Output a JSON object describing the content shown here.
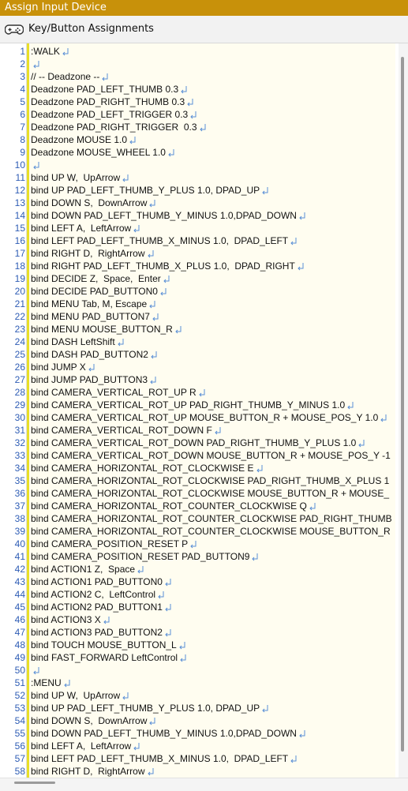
{
  "window": {
    "title": "Assign Input Device"
  },
  "header": {
    "icon": "gamepad-icon",
    "title": "Key/Button Assignments"
  },
  "colors": {
    "titlebar": "#c8910a",
    "line_numbers": "#2f5db5",
    "marker": "#5a8fd6",
    "gutter_bar": "#e8de28",
    "code_background": "#fffdf0"
  },
  "editor": {
    "lines": [
      ":WALK",
      "",
      "// -- Deadzone --",
      "Deadzone PAD_LEFT_THUMB 0.3",
      "Deadzone PAD_RIGHT_THUMB 0.3",
      "Deadzone PAD_LEFT_TRIGGER 0.3",
      "Deadzone PAD_RIGHT_TRIGGER  0.3",
      "Deadzone MOUSE 1.0",
      "Deadzone MOUSE_WHEEL 1.0",
      "",
      "bind UP W,  UpArrow",
      "bind UP PAD_LEFT_THUMB_Y_PLUS 1.0, DPAD_UP",
      "bind DOWN S,  DownArrow",
      "bind DOWN PAD_LEFT_THUMB_Y_MINUS 1.0,DPAD_DOWN",
      "bind LEFT A,  LeftArrow",
      "bind LEFT PAD_LEFT_THUMB_X_MINUS 1.0,  DPAD_LEFT",
      "bind RIGHT D,  RightArrow",
      "bind RIGHT PAD_LEFT_THUMB_X_PLUS 1.0,  DPAD_RIGHT",
      "bind DECIDE Z,  Space,  Enter",
      "bind DECIDE PAD_BUTTON0",
      "bind MENU Tab, M, Escape",
      "bind MENU PAD_BUTTON7",
      "bind MENU MOUSE_BUTTON_R",
      "bind DASH LeftShift",
      "bind DASH PAD_BUTTON2",
      "bind JUMP X",
      "bind JUMP PAD_BUTTON3",
      "bind CAMERA_VERTICAL_ROT_UP R",
      "bind CAMERA_VERTICAL_ROT_UP PAD_RIGHT_THUMB_Y_MINUS 1.0",
      "bind CAMERA_VERTICAL_ROT_UP MOUSE_BUTTON_R + MOUSE_POS_Y 1.0",
      "bind CAMERA_VERTICAL_ROT_DOWN F",
      "bind CAMERA_VERTICAL_ROT_DOWN PAD_RIGHT_THUMB_Y_PLUS 1.0",
      "bind CAMERA_VERTICAL_ROT_DOWN MOUSE_BUTTON_R + MOUSE_POS_Y -1",
      "bind CAMERA_HORIZONTAL_ROT_CLOCKWISE E",
      "bind CAMERA_HORIZONTAL_ROT_CLOCKWISE PAD_RIGHT_THUMB_X_PLUS 1",
      "bind CAMERA_HORIZONTAL_ROT_CLOCKWISE MOUSE_BUTTON_R + MOUSE_",
      "bind CAMERA_HORIZONTAL_ROT_COUNTER_CLOCKWISE Q",
      "bind CAMERA_HORIZONTAL_ROT_COUNTER_CLOCKWISE PAD_RIGHT_THUMB",
      "bind CAMERA_HORIZONTAL_ROT_COUNTER_CLOCKWISE MOUSE_BUTTON_R",
      "bind CAMERA_POSITION_RESET P",
      "bind CAMERA_POSITION_RESET PAD_BUTTON9",
      "bind ACTION1 Z,  Space",
      "bind ACTION1 PAD_BUTTON0",
      "bind ACTION2 C,  LeftControl",
      "bind ACTION2 PAD_BUTTON1",
      "bind ACTION3 X",
      "bind ACTION3 PAD_BUTTON2",
      "bind TOUCH MOUSE_BUTTON_L",
      "bind FAST_FORWARD LeftControl",
      "",
      ":MENU",
      "bind UP W,  UpArrow",
      "bind UP PAD_LEFT_THUMB_Y_PLUS 1.0, DPAD_UP",
      "bind DOWN S,  DownArrow",
      "bind DOWN PAD_LEFT_THUMB_Y_MINUS 1.0,DPAD_DOWN",
      "bind LEFT A,  LeftArrow",
      "bind LEFT PAD_LEFT_THUMB_X_MINUS 1.0,  DPAD_LEFT",
      "bind RIGHT D,  RightArrow"
    ]
  }
}
